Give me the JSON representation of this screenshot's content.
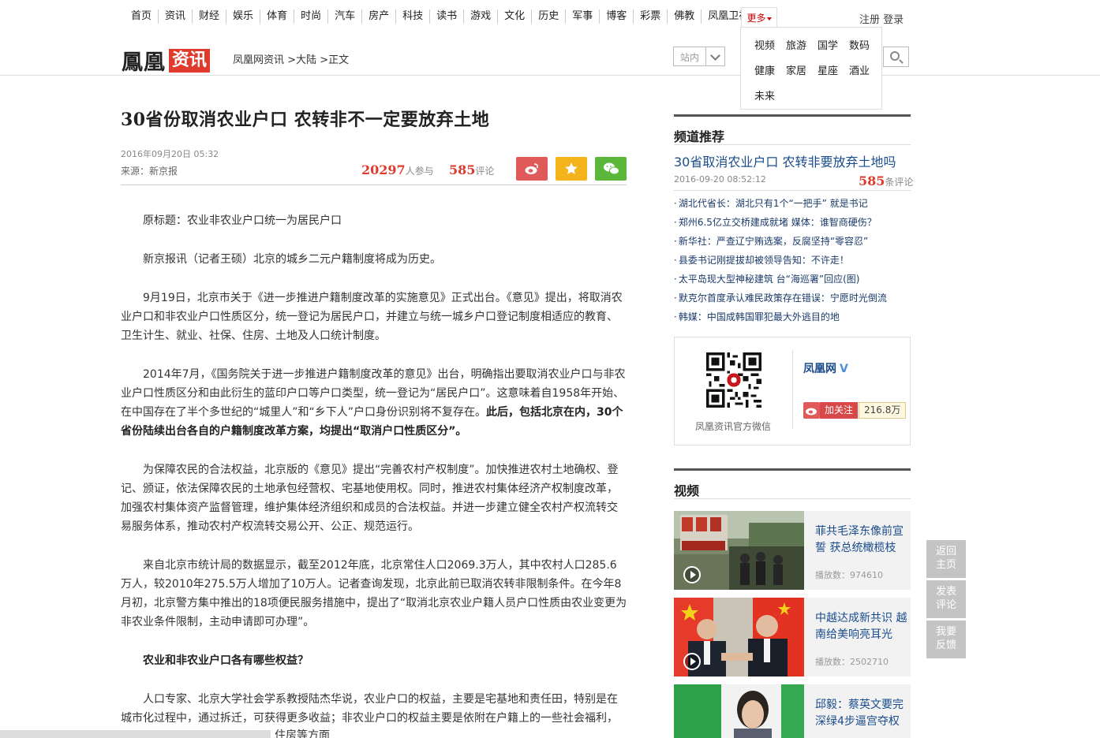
{
  "nav": {
    "items": [
      "首页",
      "资讯",
      "财经",
      "娱乐",
      "体育",
      "时尚",
      "汽车",
      "房产",
      "科技",
      "读书",
      "游戏",
      "文化",
      "历史",
      "军事",
      "博客",
      "彩票",
      "佛教",
      "凤凰卫视"
    ],
    "more_label": "更多",
    "more_menu": [
      "视频",
      "旅游",
      "国学",
      "数码",
      "健康",
      "家居",
      "星座",
      "酒业",
      "未来"
    ],
    "register": "注册",
    "login": "登录"
  },
  "header": {
    "logo_text": "鳳凰",
    "logo_badge": "资讯",
    "breadcrumb": [
      "凤凰网资讯",
      ">大陆",
      ">正文"
    ],
    "site_select": "站内"
  },
  "article": {
    "title": "30省份取消农业户口 农转非不一定要放弃土地",
    "date": "2016年09月20日 05:32",
    "source": "来源：新京报",
    "participants": "20297",
    "participants_label": "人参与",
    "comments": "585",
    "comments_label": "评论",
    "paragraphs": [
      "原标题：农业非农业户口统一为居民户口",
      "新京报讯（记者王硕）北京的城乡二元户籍制度将成为历史。",
      "9月19日，北京市关于《进一步推进户籍制度改革的实施意见》正式出台。《意见》提出，将取消农业户口和非农业户口性质区分，统一登记为居民户口，并建立与统一城乡户口登记制度相适应的教育、卫生计生、就业、社保、住房、土地及人口统计制度。",
      "2014年7月，《国务院关于进一步推进户籍制度改革的意见》出台，明确指出要取消农业户口与非农业户口性质区分和由此衍生的蓝印户口等户口类型，统一登记为“居民户口”。这意味着自1958年开始、在中国存在了半个多世纪的“城里人”和“乡下人”户口身份识别将不复存在。",
      "此后，包括北京在内，30个省份陆续出台各自的户籍制度改革方案，均提出“取消户口性质区分”。",
      "为保障农民的合法权益，北京版的《意见》提出“完善农村产权制度”。加快推进农村土地确权、登记、颁证，依法保障农民的土地承包经营权、宅基地使用权。同时，推进农村集体经济产权制度改革，加强农村集体资产监督管理，维护集体经济组织和成员的合法权益。并进一步建立健全农村产权流转交易服务体系，推动农村产权流转交易公开、公正、规范运行。",
      "来自北京市统计局的数据显示，截至2012年底，北京常住人口2069.3万人，其中农村人口285.6万人，较2010年275.5万人增加了10万人。记者查询发现，北京此前已取消农转非限制条件。在今年8月初，北京警方集中推出的18项便民服务措施中，提出了“取消北京农业户籍人员户口性质由农业变更为非农业条件限制，主动申请即可办理”。",
      "农业和非农业户口各有哪些权益？",
      "人口专家、北京大学社会学系教授陆杰华说，农业户口的权益，主要是宅基地和责任田，特别是在城市化过程中，通过拆迁，可获得更多收益；非农业户口的权益主要是依附在户籍上的一些社会福利，",
      "住房等方面"
    ]
  },
  "sidebar": {
    "channel_title": "频道推荐",
    "top_title": "30省取消农业户口 农转非要放弃土地吗",
    "top_date": "2016-09-20  08:52:12",
    "top_comments": "585",
    "top_comments_label": "条评论",
    "list": [
      "湖北代省长：湖北只有1个“一把手” 就是书记",
      "郑州6.5亿立交桥建成就堵 媒体：谁智商硬伤？",
      "新华社：严查辽宁贿选案，反腐坚持“零容忍”",
      "县委书记刚提拔却被领导告知：不许走！",
      "太平岛现大型神秘建筑 台“海巡署”回应(图)",
      "默克尔首度承认难民政策存在错误：宁愿时光倒流",
      "韩媒：中国成韩国罪犯最大外逃目的地"
    ],
    "wechat_caption": "凤凰资讯官方微信",
    "weibo_name": "凤凰网",
    "weibo_v": "V",
    "follow_label": "加关注",
    "fans": "216.8万",
    "video_title": "视频",
    "videos": [
      {
        "title": "菲共毛泽东像前宣誓 获总统橄榄枝",
        "count": "播放数：974610"
      },
      {
        "title": "中越达成新共识 越南给美响亮耳光",
        "count": "播放数：2502710"
      },
      {
        "title": "邱毅：蔡英文要完深绿4步逼宫夺权",
        "count": ""
      }
    ]
  },
  "float_buttons": [
    "返回\n主页",
    "发表\n评论",
    "我要\n反馈"
  ],
  "colors": {
    "accent": "#e03a2c",
    "link": "#1a4c8c",
    "weibo": "#e05a5a",
    "favorite": "#f2b31b",
    "wechat": "#5bb73a"
  }
}
